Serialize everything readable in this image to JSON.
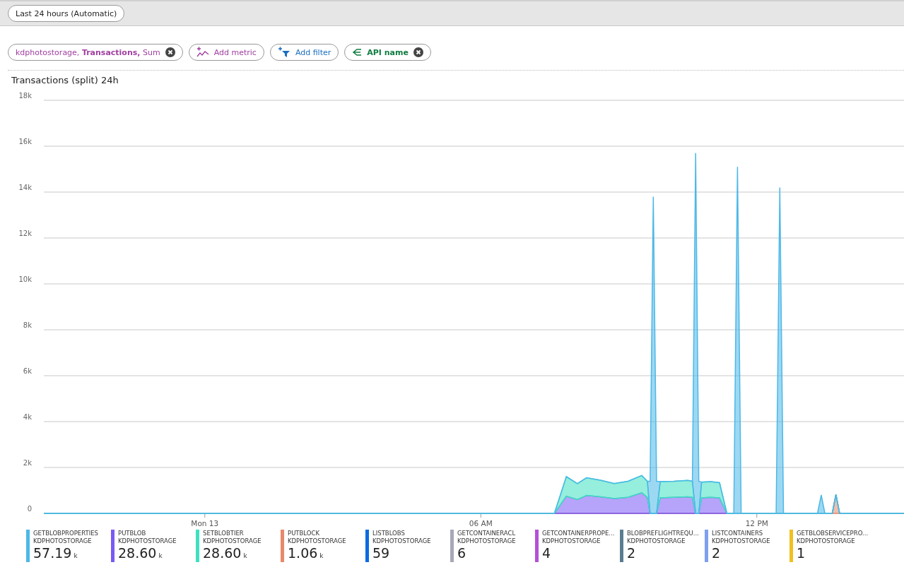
{
  "time_range": {
    "label": "Last 24 hours (Automatic)"
  },
  "toolbar": {
    "metric_pill": "kdphotostorage, **Transactions,** Sum",
    "add_metric": "Add metric",
    "add_filter": "Add filter",
    "split_pill": "API name"
  },
  "chart": {
    "title": "Transactions (split) 24h",
    "chart_data": {
      "type": "area",
      "stacked": true,
      "grid": true,
      "xlim": [
        -3.5,
        15.2
      ],
      "ylim": [
        0,
        18000
      ],
      "xticks": [
        {
          "value": 0,
          "label": "Mon 13"
        },
        {
          "value": 6,
          "label": "06 AM"
        },
        {
          "value": 12,
          "label": "12 PM"
        }
      ],
      "yticks": [
        {
          "value": 0,
          "label": "0"
        },
        {
          "value": 2000,
          "label": "2k"
        },
        {
          "value": 4000,
          "label": "4k"
        },
        {
          "value": 6000,
          "label": "6k"
        },
        {
          "value": 8000,
          "label": "8k"
        },
        {
          "value": 10000,
          "label": "10k"
        },
        {
          "value": 12000,
          "label": "12k"
        },
        {
          "value": 14000,
          "label": "14k"
        },
        {
          "value": 16000,
          "label": "16k"
        },
        {
          "value": 18000,
          "label": "18k"
        }
      ],
      "x": [
        -3.5,
        7.6,
        7.86,
        8.1,
        8.3,
        8.6,
        8.9,
        9.2,
        9.5,
        9.62,
        9.68,
        9.75,
        9.82,
        9.9,
        10.2,
        10.5,
        10.6,
        10.67,
        10.74,
        10.8,
        11.0,
        11.19,
        11.35,
        11.5,
        11.58,
        11.66,
        12.42,
        12.5,
        12.58,
        13.32,
        13.4,
        13.48,
        13.64,
        13.72,
        13.8,
        15.2
      ],
      "series": [
        {
          "name": "PUTBLOCK",
          "color": "#e8896a",
          "values": [
            0,
            0,
            0,
            0,
            0,
            0,
            0,
            0,
            0,
            0,
            0,
            0,
            0,
            0,
            0,
            0,
            0,
            0,
            0,
            0,
            0,
            0,
            0,
            0,
            0,
            0,
            0,
            0,
            0,
            0,
            0,
            0,
            0,
            820,
            0,
            0
          ]
        },
        {
          "name": "PUTBLOB",
          "color": "#7a5af5",
          "values": [
            0,
            0,
            750,
            600,
            780,
            720,
            650,
            700,
            900,
            700,
            0,
            0,
            0,
            680,
            700,
            720,
            700,
            0,
            0,
            680,
            700,
            680,
            0,
            0,
            0,
            0,
            0,
            0,
            0,
            0,
            0,
            0,
            0,
            0,
            0,
            0
          ]
        },
        {
          "name": "SETBLOBTIER",
          "color": "#3fe0c0",
          "values": [
            0,
            0,
            850,
            700,
            770,
            730,
            650,
            700,
            750,
            700,
            0,
            0,
            0,
            700,
            700,
            720,
            700,
            0,
            0,
            680,
            680,
            660,
            0,
            0,
            0,
            0,
            0,
            0,
            0,
            0,
            0,
            0,
            0,
            0,
            0,
            0
          ]
        },
        {
          "name": "GETBLOBPROPERTIES",
          "color": "#4db8e8",
          "values": [
            0,
            0,
            0,
            0,
            0,
            0,
            0,
            0,
            0,
            0,
            1400,
            13800,
            1400,
            0,
            0,
            0,
            0,
            15700,
            1400,
            0,
            0,
            0,
            0,
            0,
            15100,
            0,
            0,
            14200,
            0,
            0,
            800,
            0,
            0,
            0,
            0,
            0
          ]
        }
      ]
    }
  },
  "legend": [
    {
      "resource": "KDPHOTOSTORAGE",
      "value": "57.19",
      "unit": "k"
    },
    {
      "resource": "KDPHOTOSTORAGE",
      "value": "28.60",
      "unit": "k"
    },
    {
      "resource": "KDPHOTOSTORAGE",
      "value": "28.60",
      "unit": "k"
    },
    {
      "resource": "KDPHOTOSTORAGE",
      "value": "1.06",
      "unit": "k"
    },
    {
      "name": "LISTBLOBS",
      "resource": "KDPHOTOSTORAGE",
      "value": "59",
      "color": "#0b6be0"
    },
    {
      "name": "GETCONTAINERACL",
      "resource": "KDPHOTOSTORAGE",
      "value": "6",
      "color": "#a8a8b8"
    },
    {
      "name": "GETCONTAINERPROPE...",
      "resource": "KDPHOTOSTORAGE",
      "value": "4",
      "color": "#b450d8"
    },
    {
      "name": "BLOBPREFLIGHTREQU...",
      "resource": "KDPHOTOSTORAGE",
      "value": "2",
      "color": "#5a7c90"
    },
    {
      "name": "LISTCONTAINERS",
      "resource": "KDPHOTOSTORAGE",
      "value": "2",
      "color": "#7fa0f0"
    },
    {
      "name": "GETBLOBSERVICEPRO...",
      "resource": "KDPHOTOSTORAGE",
      "value": "1",
      "color": "#f0c020"
    }
  ]
}
